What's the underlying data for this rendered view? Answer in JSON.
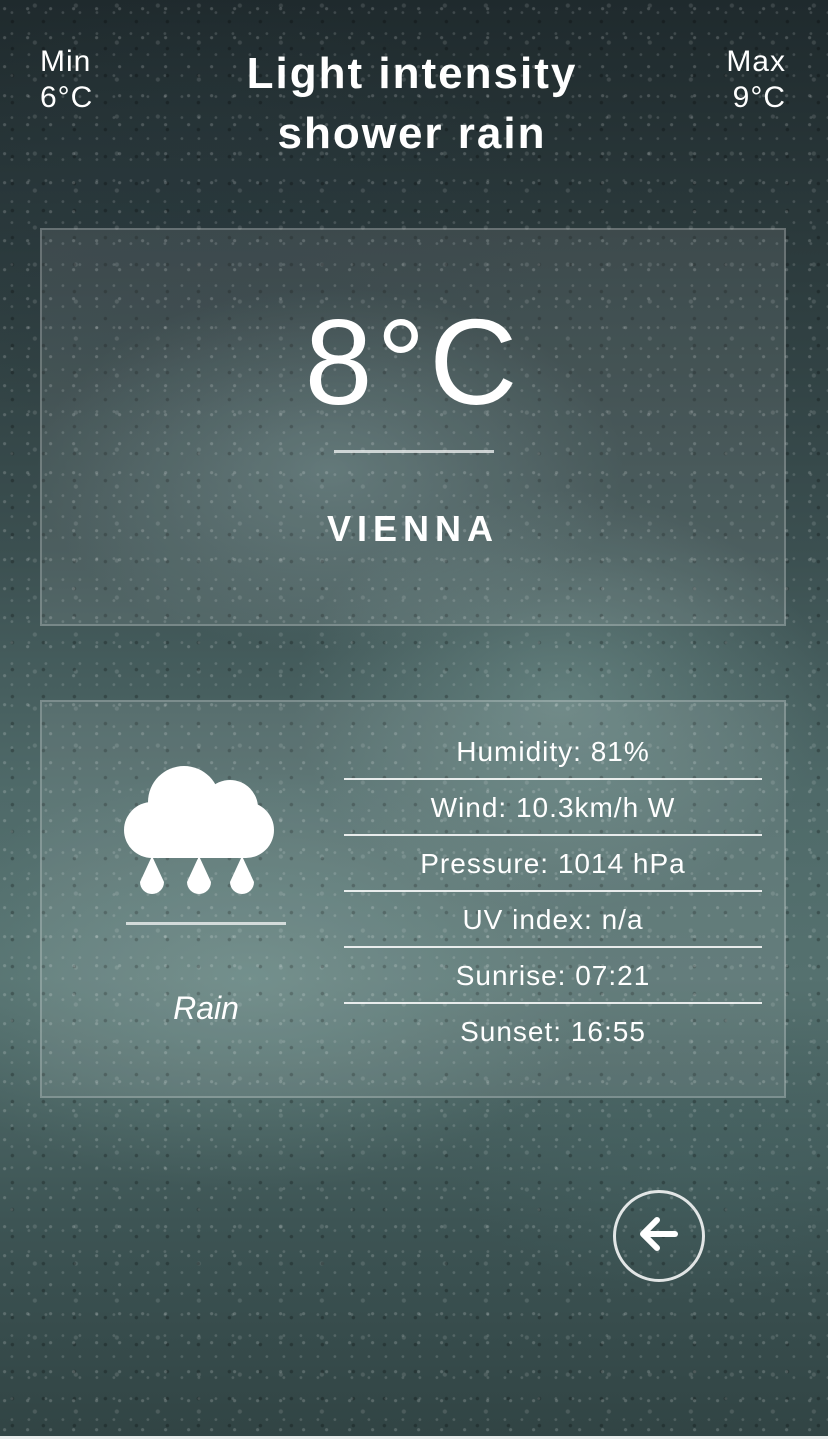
{
  "header": {
    "min_label": "Min",
    "min_value": "6°C",
    "condition": "Light intensity shower rain",
    "max_label": "Max",
    "max_value": "9°C"
  },
  "current": {
    "temperature": "8°C",
    "city": "VIENNA"
  },
  "details": {
    "icon": "cloud-rain-icon",
    "description": "Rain",
    "rows": [
      "Humidity: 81%",
      "Wind: 10.3km/h W",
      "Pressure: 1014 hPa",
      "UV index: n/a",
      "Sunrise: 07:21",
      "Sunset: 16:55"
    ]
  },
  "navigation": {
    "back_icon": "arrow-left-icon"
  },
  "colors": {
    "text": "#ffffff",
    "panel": "rgba(255,255,255,0.09)"
  }
}
